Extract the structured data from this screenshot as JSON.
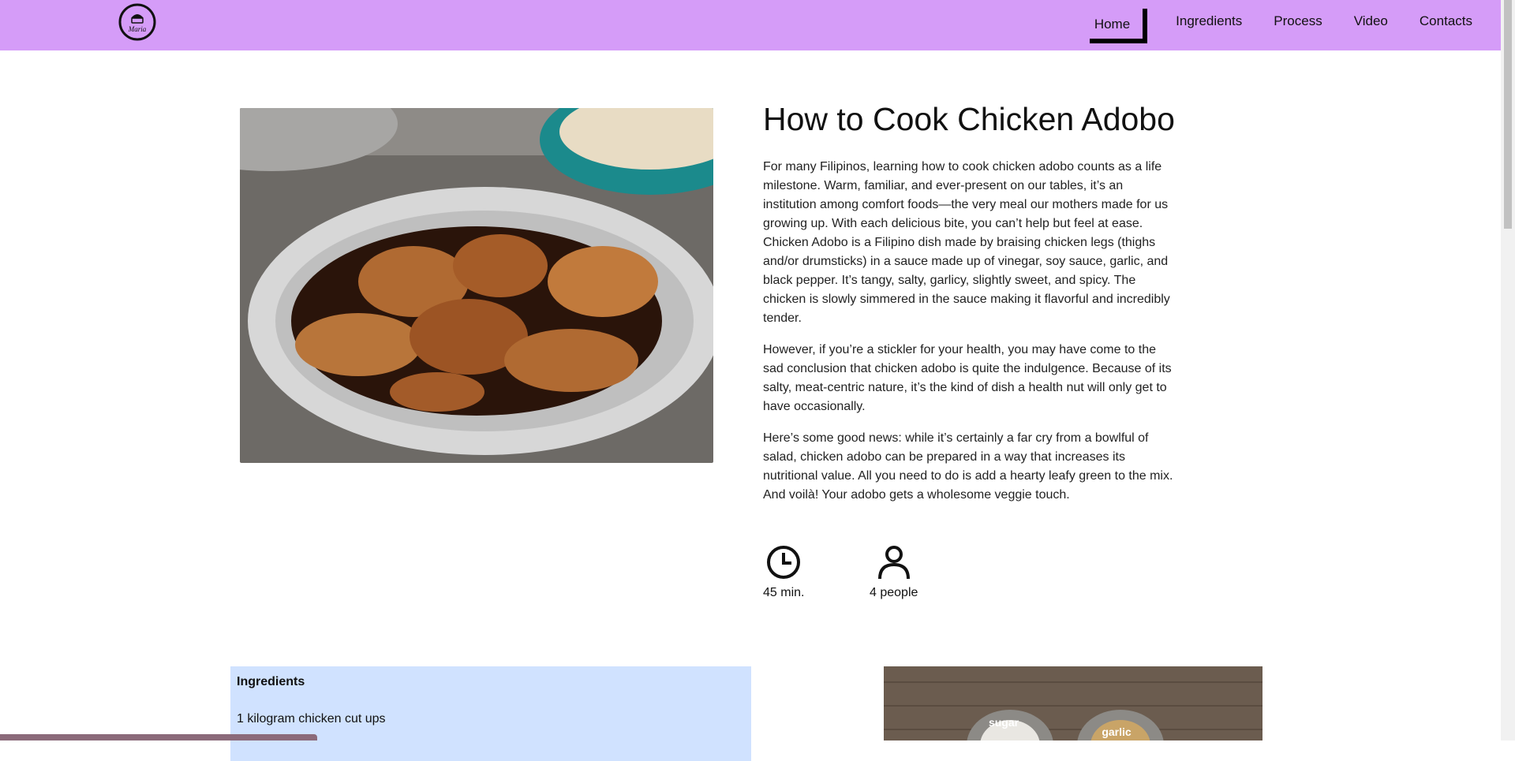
{
  "nav": {
    "items": [
      {
        "label": "Home",
        "active": true
      },
      {
        "label": "Ingredients",
        "active": false
      },
      {
        "label": "Process",
        "active": false
      },
      {
        "label": "Video",
        "active": false
      },
      {
        "label": "Contacts",
        "active": false
      }
    ],
    "logo_text": "Maria"
  },
  "colors": {
    "navbar": "#d59cf8",
    "ingredients_bg": "#d0e2ff",
    "status_bar": "#8b6a7a"
  },
  "article": {
    "title": "How to Cook Chicken Adobo",
    "paragraphs": [
      "For many Filipinos, learning how to cook chicken adobo counts as a life milestone. Warm, familiar, and ever-present on our tables, it’s an institution among comfort foods—the very meal our mothers made for us growing up. With each delicious bite, you can’t help but feel at ease. Chicken Adobo is a Filipino dish made by braising chicken legs (thighs and/or drumsticks) in a sauce made up of vinegar, soy sauce, garlic, and black pepper. It’s tangy, salty, garlicy, slightly sweet, and spicy. The chicken is slowly simmered in the sauce making it flavorful and incredibly tender.",
      "However, if you’re a stickler for your health, you may have come to the sad conclusion that chicken adobo is quite the indulgence. Because of its salty, meat-centric nature, it’s the kind of dish a health nut will only get to have occasionally.",
      "Here’s some good news: while it’s certainly a far cry from a bowlful of salad, chicken adobo can be prepared in a way that increases its nutritional value. All you need to do is add a hearty leafy green to the mix. And voilà! Your adobo gets a wholesome veggie touch."
    ]
  },
  "meta": {
    "time": {
      "icon": "clock-icon",
      "label": "45 min."
    },
    "servings": {
      "icon": "person-icon",
      "label": "4 people"
    }
  },
  "ingredients": {
    "title": "Ingredients",
    "first_item": "1 kilogram chicken cut ups"
  },
  "spices_image": {
    "labels": [
      "sugar",
      "garlic"
    ]
  }
}
